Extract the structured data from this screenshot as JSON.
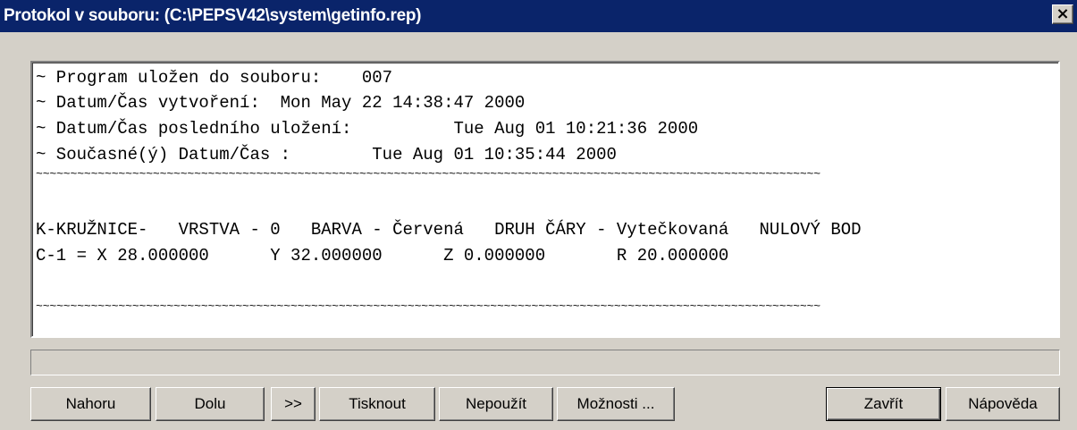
{
  "window": {
    "title": "Protokol v souboru: (C:\\PEPSV42\\system\\getinfo.rep)",
    "close_label": "×"
  },
  "report": {
    "lines": [
      "~ Program uložen do souboru:    007",
      "~ Datum/Čas vytvoření:  Mon May 22 14:38:47 2000",
      "~ Datum/Čas posledního uložení:          Tue Aug 01 10:21:36 2000",
      "~ Současné(ý) Datum/Čas :        Tue Aug 01 10:35:44 2000",
      "~~~~~~~~~~~~~~~~~~~~~~~~~~~~~~~~~~~~~~~~~~~~~~~~~~~~~~~~~~~~~~~~~~~~~~~~~~~~~~~~~~~~~~~~~~~~~~~~~~~~~~~~~~~~~~~~~~",
      "",
      "K-KRUŽNICE-   VRSTVA - 0   BARVA - Červená   DRUH ČÁRY - Vytečkovaná   NULOVÝ BOD",
      "C-1 = X 28.000000      Y 32.000000      Z 0.000000       R 20.000000",
      "",
      "",
      "~~~~~~~~~~~~~~~~~~~~~~~~~~~~~~~~~~~~~~~~~~~~~~~~~~~~~~~~~~~~~~~~~~~~~~~~~~~~~~~~~~~~~~~~~~~~~~~~~~~~~~~~~~~~~~~~~~"
    ]
  },
  "status": {
    "text": ""
  },
  "buttons": {
    "up": "Nahoru",
    "down": "Dolu",
    "next": ">>",
    "print": "Tisknout",
    "unused": "Nepoužít",
    "options": "Možnosti ...",
    "close": "Zavřít",
    "help": "Nápověda"
  }
}
